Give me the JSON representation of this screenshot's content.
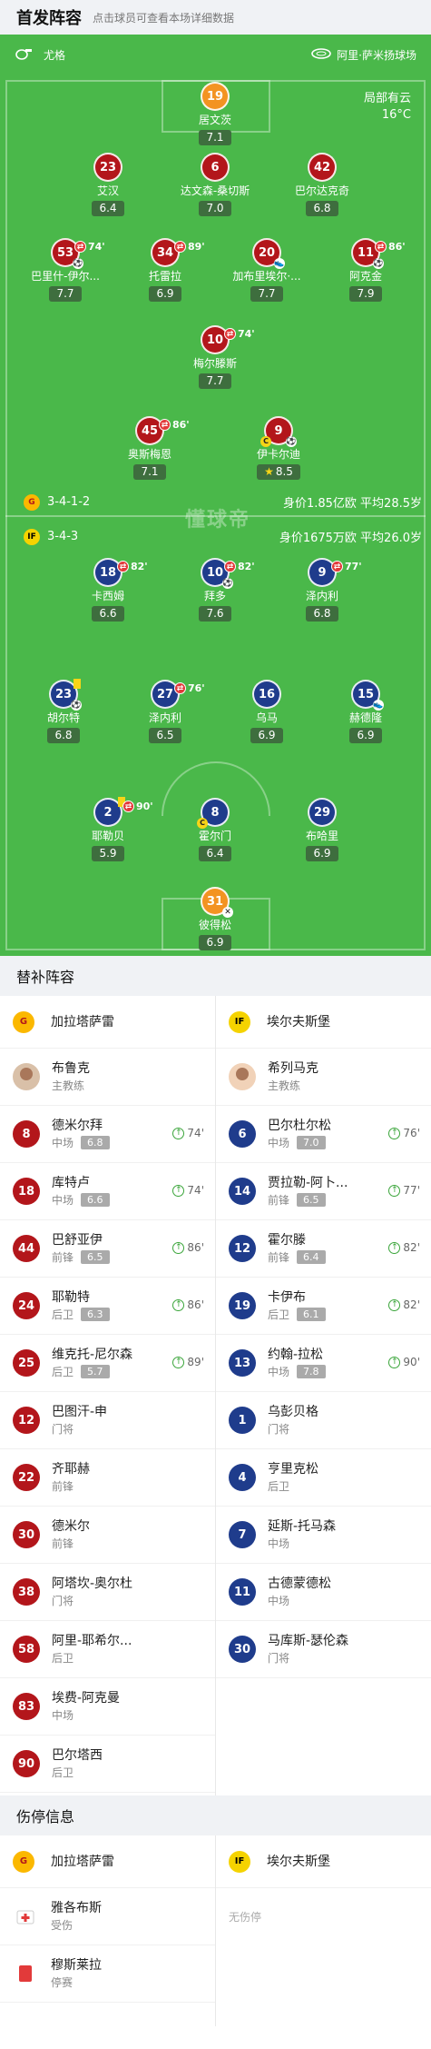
{
  "header": {
    "title": "首发阵容",
    "subtitle": "点击球员可查看本场详细数据"
  },
  "match": {
    "home_coach_tag": "尤格",
    "venue": "阿里·萨米扬球场",
    "weather": "局部有云",
    "temperature": "16°C"
  },
  "home_team": {
    "formation": "3-4-1-2",
    "stats": "身价1.85亿欧  平均28.5岁"
  },
  "away_team": {
    "formation": "3-4-3",
    "stats": "身价1675万欧  平均26.0岁"
  },
  "watermark": "懂球帝",
  "home_players": [
    {
      "num": "19",
      "name": "居文茨",
      "rating": "7.1"
    },
    {
      "num": "23",
      "name": "艾汉",
      "rating": "6.4"
    },
    {
      "num": "6",
      "name": "达文森-桑切斯",
      "rating": "7.0"
    },
    {
      "num": "42",
      "name": "巴尔达克奇",
      "rating": "6.8"
    },
    {
      "num": "53",
      "name": "巴里什-伊尔...",
      "rating": "7.7",
      "sub": "74'"
    },
    {
      "num": "34",
      "name": "托雷拉",
      "rating": "6.9",
      "sub": "89'"
    },
    {
      "num": "20",
      "name": "加布里埃尔·...",
      "rating": "7.7"
    },
    {
      "num": "11",
      "name": "阿克金",
      "rating": "7.9",
      "sub": "86'"
    },
    {
      "num": "10",
      "name": "梅尔滕斯",
      "rating": "7.7",
      "sub": "74'"
    },
    {
      "num": "45",
      "name": "奥斯梅恩",
      "rating": "7.1",
      "sub": "86'"
    },
    {
      "num": "9",
      "name": "伊卡尔迪",
      "rating": "8.5"
    }
  ],
  "away_players": [
    {
      "num": "18",
      "name": "卡西姆",
      "rating": "6.6",
      "sub": "82'"
    },
    {
      "num": "10",
      "name": "拜多",
      "rating": "7.6",
      "sub": "82'"
    },
    {
      "num": "9",
      "name": "泽内利",
      "rating": "6.8",
      "sub": "77'"
    },
    {
      "num": "23",
      "name": "胡尔特",
      "rating": "6.8"
    },
    {
      "num": "27",
      "name": "泽内利",
      "rating": "6.5",
      "sub": "76'"
    },
    {
      "num": "16",
      "name": "乌马",
      "rating": "6.9"
    },
    {
      "num": "15",
      "name": "赫德隆",
      "rating": "6.9"
    },
    {
      "num": "2",
      "name": "耶勒贝",
      "rating": "5.9",
      "sub": "90'"
    },
    {
      "num": "8",
      "name": "霍尔门",
      "rating": "6.4"
    },
    {
      "num": "29",
      "name": "布哈里",
      "rating": "6.9"
    },
    {
      "num": "31",
      "name": "彼得松",
      "rating": "6.9"
    }
  ],
  "bench": {
    "title": "替补阵容",
    "home": {
      "team": "加拉塔萨雷",
      "coach": {
        "name": "布鲁克",
        "role": "主教练"
      },
      "players": [
        {
          "num": "8",
          "name": "德米尔拜",
          "pos": "中场",
          "rating": "6.8",
          "in": "74'"
        },
        {
          "num": "18",
          "name": "库特卢",
          "pos": "中场",
          "rating": "6.6",
          "in": "74'"
        },
        {
          "num": "44",
          "name": "巴舒亚伊",
          "pos": "前锋",
          "rating": "6.5",
          "in": "86'"
        },
        {
          "num": "24",
          "name": "耶勒特",
          "pos": "后卫",
          "rating": "6.3",
          "in": "86'"
        },
        {
          "num": "25",
          "name": "维克托-尼尔森",
          "pos": "后卫",
          "rating": "5.7",
          "in": "89'"
        },
        {
          "num": "12",
          "name": "巴图汗-申",
          "pos": "门将"
        },
        {
          "num": "22",
          "name": "齐耶赫",
          "pos": "前锋"
        },
        {
          "num": "30",
          "name": "德米尔",
          "pos": "前锋"
        },
        {
          "num": "38",
          "name": "阿塔坎-奥尔杜",
          "pos": "门将"
        },
        {
          "num": "58",
          "name": "阿里-耶希尔...",
          "pos": "后卫"
        },
        {
          "num": "83",
          "name": "埃费-阿克曼",
          "pos": "中场"
        },
        {
          "num": "90",
          "name": "巴尔塔西",
          "pos": "后卫"
        }
      ]
    },
    "away": {
      "team": "埃尔夫斯堡",
      "coach": {
        "name": "希列马克",
        "role": "主教练"
      },
      "players": [
        {
          "num": "6",
          "name": "巴尔杜尔松",
          "pos": "中场",
          "rating": "7.0",
          "in": "76'"
        },
        {
          "num": "14",
          "name": "贾拉勒-阿卜...",
          "pos": "前锋",
          "rating": "6.5",
          "in": "77'"
        },
        {
          "num": "12",
          "name": "霍尔滕",
          "pos": "前锋",
          "rating": "6.4",
          "in": "82'"
        },
        {
          "num": "19",
          "name": "卡伊布",
          "pos": "后卫",
          "rating": "6.1",
          "in": "82'"
        },
        {
          "num": "13",
          "name": "约翰-拉松",
          "pos": "中场",
          "rating": "7.8",
          "in": "90'"
        },
        {
          "num": "1",
          "name": "乌彭贝格",
          "pos": "门将"
        },
        {
          "num": "4",
          "name": "亨里克松",
          "pos": "后卫"
        },
        {
          "num": "7",
          "name": "延斯-托马森",
          "pos": "中场"
        },
        {
          "num": "11",
          "name": "古德蒙德松",
          "pos": "中场"
        },
        {
          "num": "30",
          "name": "马库斯-瑟伦森",
          "pos": "门将"
        }
      ]
    }
  },
  "injuries": {
    "title": "伤停信息",
    "home_team": "加拉塔萨雷",
    "away_team": "埃尔夫斯堡",
    "home": [
      {
        "name": "雅各布斯",
        "status": "受伤"
      },
      {
        "name": "穆斯莱拉",
        "status": "停赛"
      }
    ],
    "away_none": "无伤停"
  },
  "colors": {
    "home": "#b3161b",
    "home_gk": "#f39322",
    "away": "#1f3c8c",
    "pitch": "#4ab84a"
  }
}
